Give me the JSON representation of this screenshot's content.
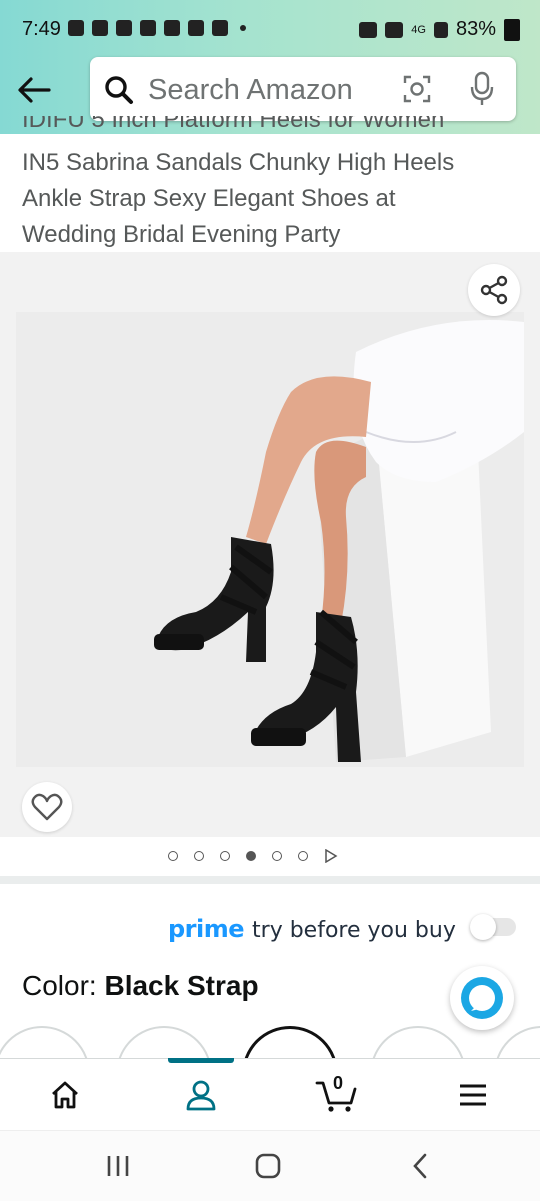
{
  "status_bar": {
    "time": "7:49",
    "network": "4G",
    "battery": "83%"
  },
  "header": {
    "back_icon": "arrow-left-icon",
    "search": {
      "placeholder": "Search Amazon",
      "value": ""
    },
    "camera_icon": "camera-lens-icon",
    "mic_icon": "microphone-icon"
  },
  "product": {
    "title_partial_line": "IDIFU 5 Inch Platform Heels for Women",
    "title_lines": [
      "IN5 Sabrina Sandals Chunky High Heels",
      "Ankle Strap Sexy Elegant Shoes at",
      "Wedding Bridal Evening Party"
    ],
    "image_alt": "Woman wearing black ankle-strap chunky platform heels",
    "carousel": {
      "count": 6,
      "active_index": 3,
      "has_video": true
    }
  },
  "prime": {
    "brand": "prime",
    "text": "try before you buy",
    "toggle_on": false
  },
  "variation": {
    "label": "Color:",
    "value": "Black Strap"
  },
  "bottom_nav": {
    "items": [
      "home-icon",
      "account-icon",
      "cart-icon",
      "menu-icon"
    ],
    "active": "account-icon",
    "cart_count": "0"
  },
  "colors": {
    "accent_teal": "#007185",
    "prime_blue": "#1a98ff",
    "header_gradient_start": "#85d9d3",
    "header_gradient_end": "#bfe7c9"
  }
}
